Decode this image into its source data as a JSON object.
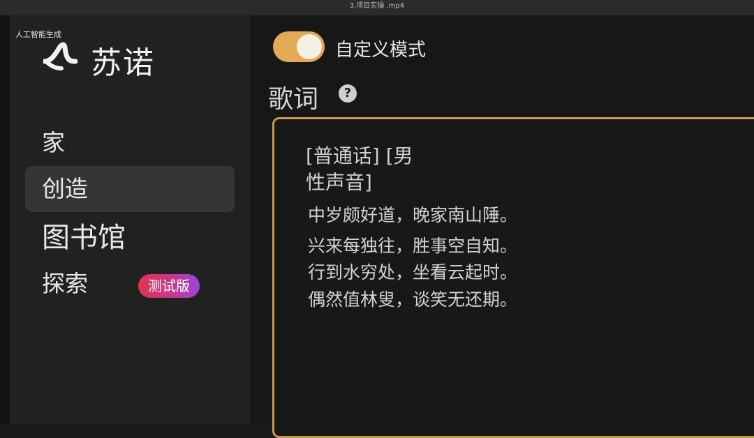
{
  "window": {
    "title": "3.项目实操 .mp4"
  },
  "watermark": "人工智能生成",
  "brand": {
    "name": "苏诺"
  },
  "nav": {
    "items": [
      {
        "label": "家"
      },
      {
        "label": "创造"
      },
      {
        "label": "图书馆"
      },
      {
        "label": "探索"
      }
    ],
    "explore_badge": "测试版"
  },
  "main": {
    "custom_mode_label": "自定义模式",
    "custom_mode_on": true,
    "lyrics_title": "歌词",
    "help_glyph": "?",
    "lyrics": {
      "tag_line1": "[普通话] [男",
      "tag_line2": "性声音]",
      "lines": [
        "中岁颇好道，晚家南山陲。",
        "兴来每独往，胜事空自知。",
        "行到水穷处，坐看云起时。",
        "偶然值林叟，谈笑无还期。"
      ]
    }
  },
  "colors": {
    "accent": "#e2aa55",
    "border": "#c99a4e",
    "badge_start": "#e0334e",
    "badge_end": "#9a45d8"
  }
}
